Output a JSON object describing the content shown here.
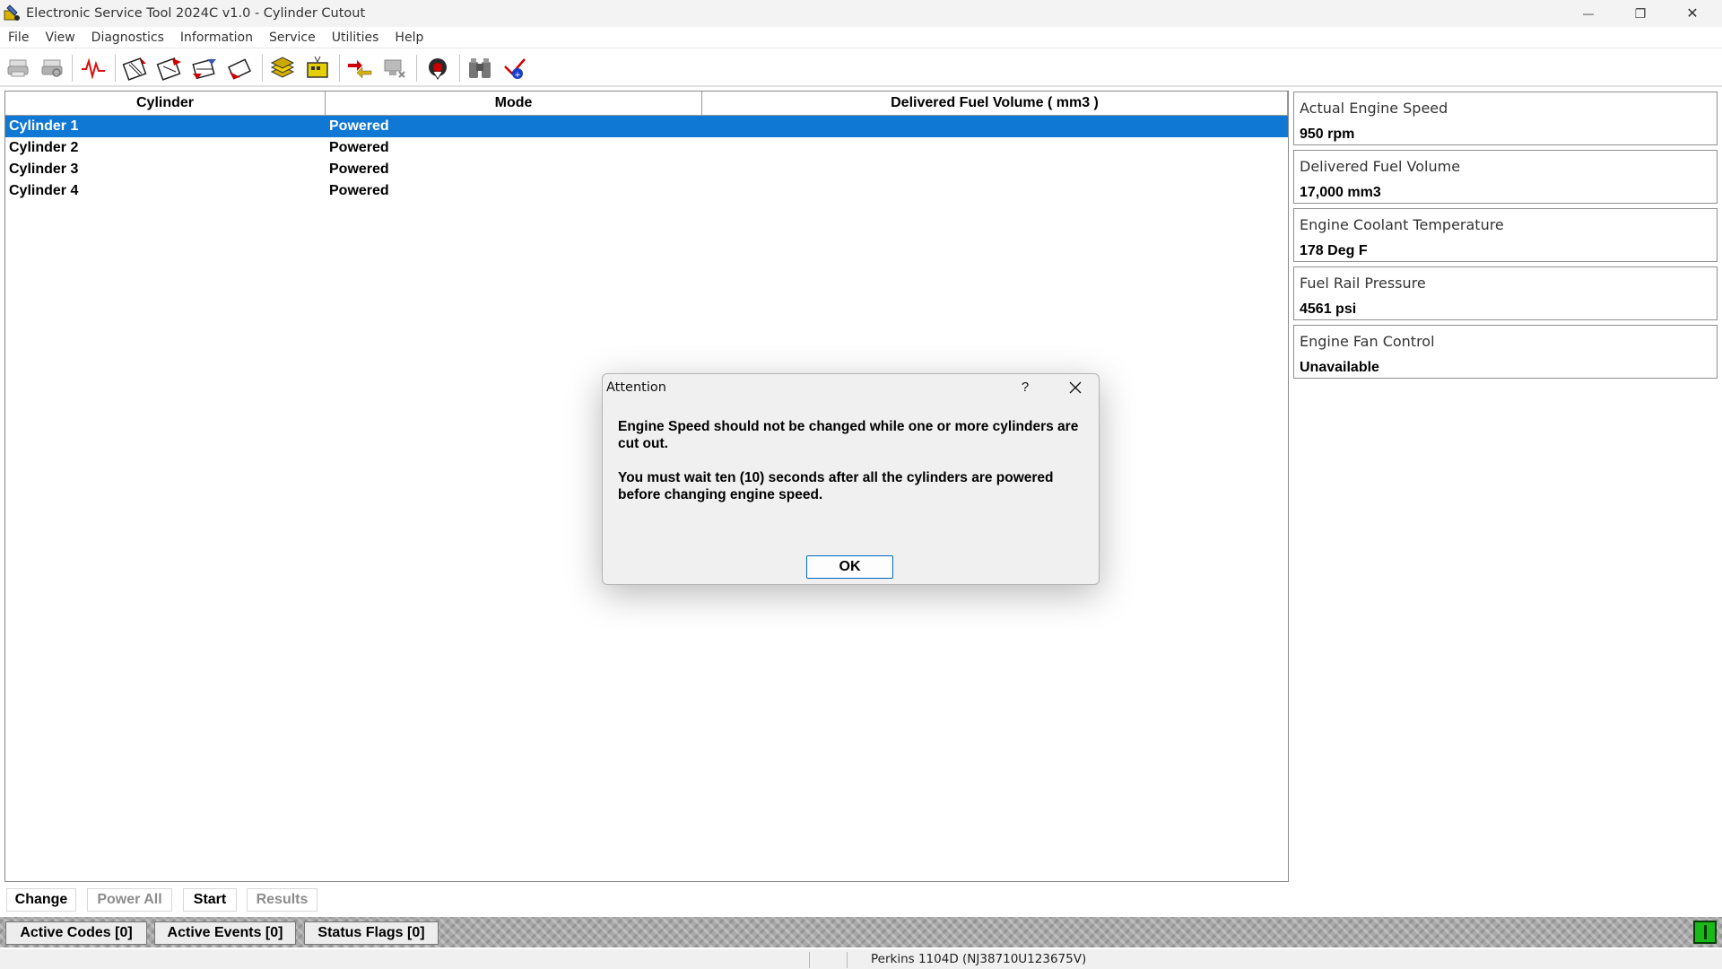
{
  "window": {
    "title": "Electronic Service Tool 2024C v1.0 - Cylinder Cutout",
    "minimize_glyph": "—",
    "restore_glyph": "❐",
    "close_glyph": "✕"
  },
  "menu": {
    "items": [
      "File",
      "View",
      "Diagnostics",
      "Information",
      "Service",
      "Utilities",
      "Help"
    ]
  },
  "toolbar": {
    "icons": [
      "print-icon",
      "print-preview-icon",
      "waveform-icon",
      "ecm-tool-1-icon",
      "ecm-tool-2-icon",
      "ecm-tool-3-icon",
      "ecm-tool-4-icon",
      "flash-file-icon",
      "yellow-module-icon",
      "connect-arrows-icon",
      "disconnect-icon",
      "target-hand-icon",
      "binoculars-icon",
      "reset-icon"
    ]
  },
  "table": {
    "headers": [
      "Cylinder",
      "Mode",
      "Delivered Fuel Volume ( mm3 )"
    ],
    "rows": [
      {
        "cylinder": "Cylinder 1",
        "mode": "Powered",
        "volume": ""
      },
      {
        "cylinder": "Cylinder 2",
        "mode": "Powered",
        "volume": ""
      },
      {
        "cylinder": "Cylinder 3",
        "mode": "Powered",
        "volume": ""
      },
      {
        "cylinder": "Cylinder 4",
        "mode": "Powered",
        "volume": ""
      }
    ],
    "selected_row": 0
  },
  "status_panels": [
    {
      "label": "Actual Engine Speed",
      "value": "950 rpm"
    },
    {
      "label": "Delivered Fuel Volume",
      "value": "17,000 mm3"
    },
    {
      "label": "Engine Coolant Temperature",
      "value": "178 Deg F"
    },
    {
      "label": "Fuel Rail Pressure",
      "value": "4561 psi"
    },
    {
      "label": "Engine Fan Control",
      "value": "Unavailable"
    }
  ],
  "actions": {
    "change": "Change",
    "power_all": "Power All",
    "start": "Start",
    "results": "Results"
  },
  "status_bar": {
    "active_codes": "Active Codes [0]",
    "active_events": "Active Events [0]",
    "status_flags": "Status Flags [0]",
    "indicator_color": "#18b918"
  },
  "footer": {
    "engine": "Perkins 1104D (NJ38710U123675V)"
  },
  "dialog": {
    "title": "Attention",
    "help_glyph": "?",
    "message_1": "Engine Speed should not be changed while one or more cylinders are cut out.",
    "message_2": "You must wait ten (10) seconds after all the cylinders are powered before changing engine speed.",
    "ok_label": "OK"
  },
  "colors": {
    "selection": "#0f78d4",
    "accent_border": "#0067c0"
  }
}
